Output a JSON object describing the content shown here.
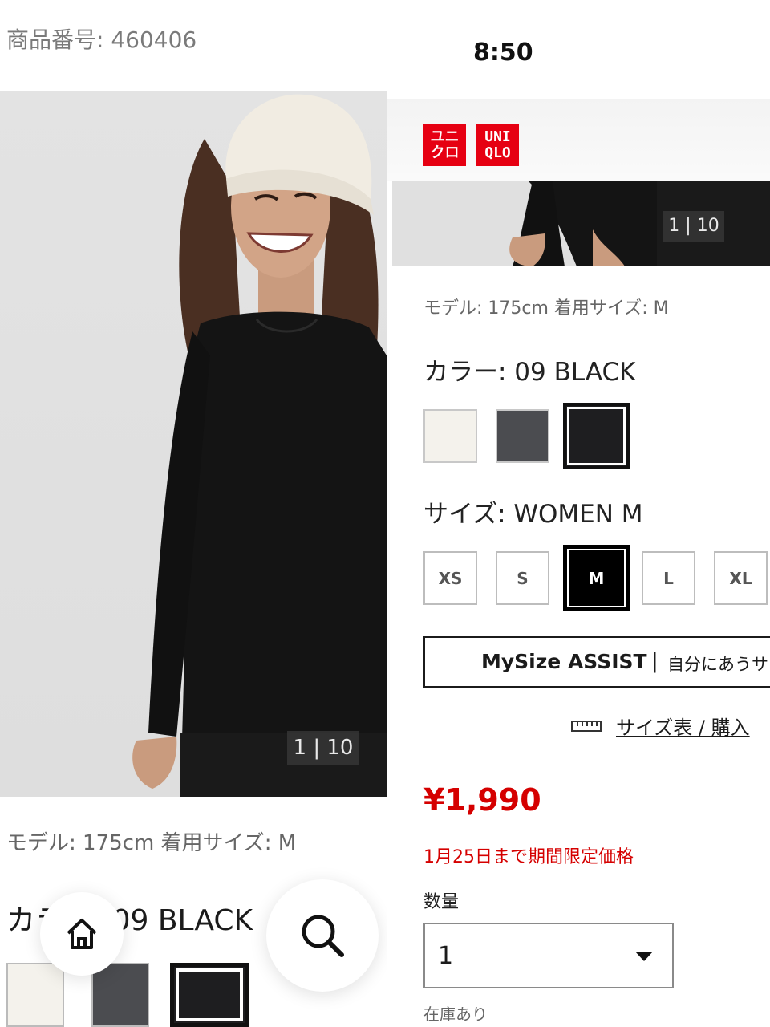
{
  "left_panel": {
    "product_code": "商品番号: 460406",
    "image_counter": "1 | 10",
    "model_info": "モデル: 175cm 着用サイズ: M",
    "color_label": "カラー: 09 BLACK",
    "swatches": [
      "#f4f2ec",
      "#4b4c50",
      "#1e1e20"
    ],
    "fab_home_icon": "home-icon",
    "fab_search_icon": "search-icon"
  },
  "right_panel": {
    "status_time": "8:50",
    "logo": {
      "katakana_top": "ユニ",
      "katakana_bottom": "クロ",
      "latin_top": "UNI",
      "latin_bottom": "QLO",
      "color": "#e60012"
    },
    "image_counter": "1 | 10",
    "model_info": "モデル: 175cm 着用サイズ: M",
    "color_label": "カラー: 09 BLACK",
    "color_swatches": [
      {
        "name": "off-white",
        "hex": "#f4f2ec",
        "selected": false
      },
      {
        "name": "dark-gray",
        "hex": "#4b4c50",
        "selected": false
      },
      {
        "name": "black",
        "hex": "#1e1e20",
        "selected": true
      }
    ],
    "size_label": "サイズ: WOMEN M",
    "sizes": [
      {
        "label": "XS",
        "selected": false
      },
      {
        "label": "S",
        "selected": false
      },
      {
        "label": "M",
        "selected": true
      },
      {
        "label": "L",
        "selected": false
      },
      {
        "label": "XL",
        "selected": false
      }
    ],
    "mysize": {
      "brand": "MySize ASSIST",
      "separator": "|",
      "text": "自分にあうサ"
    },
    "size_chart_link": "サイズ表 / 購入",
    "size_chart_icon": "ruler-icon",
    "price": "¥1,990",
    "promo": "1月25日まで期間限定価格",
    "quantity_label": "数量",
    "quantity_value": "1",
    "stock_status": "在庫あり",
    "accent_color": "#d50000"
  }
}
